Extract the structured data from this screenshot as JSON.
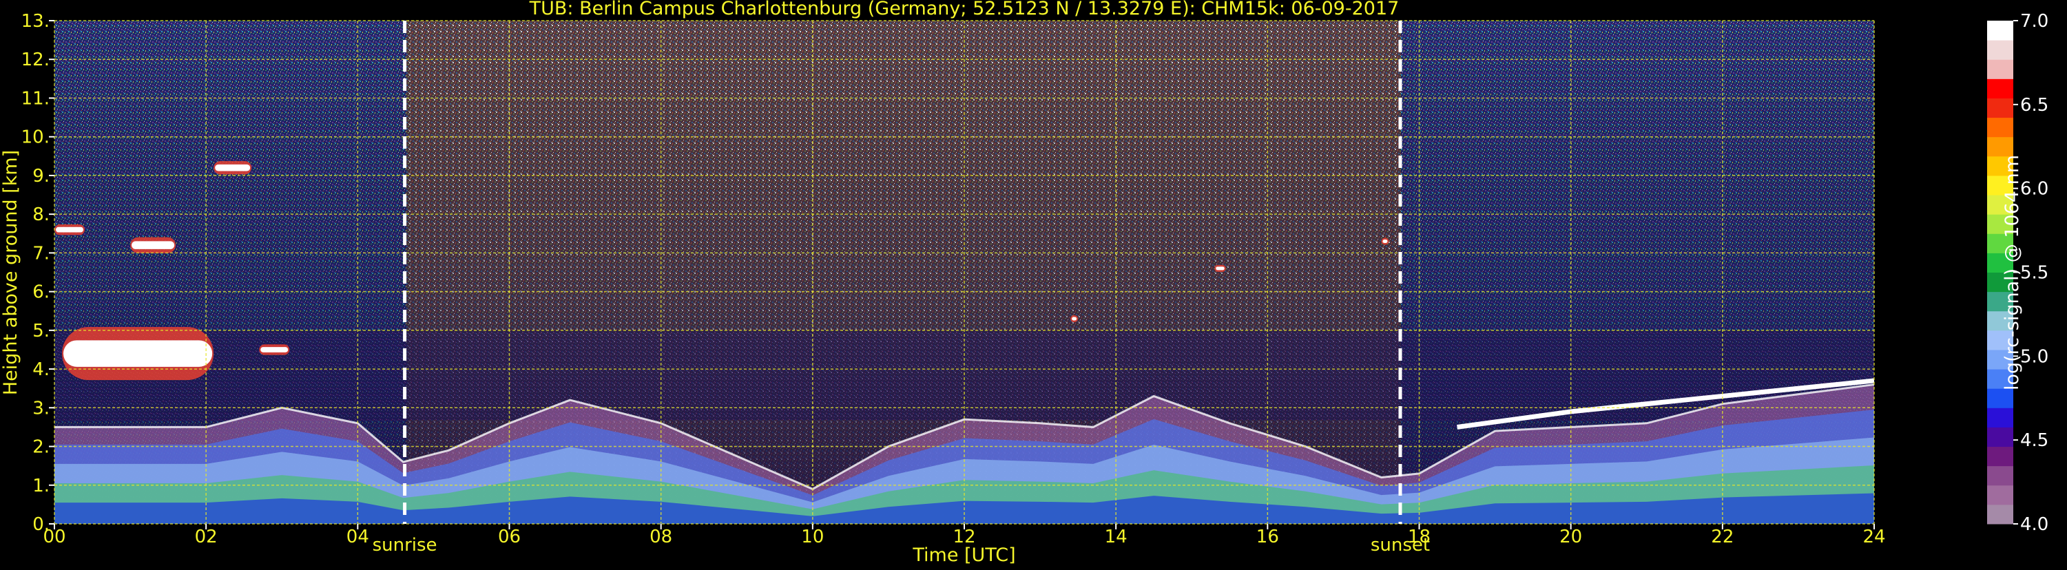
{
  "chart_data": {
    "type": "heatmap",
    "title": "TUB: Berlin Campus Charlottenburg (Germany; 52.5123 N / 13.3279 E):    CHM15k: 06-09-2017",
    "xlabel": "Time [UTC]",
    "ylabel": "Height above ground [km]",
    "x_range": [
      0,
      24
    ],
    "y_range": [
      0,
      13
    ],
    "x_tick_values": [
      0,
      2,
      4,
      6,
      8,
      10,
      12,
      14,
      16,
      18,
      20,
      22,
      24
    ],
    "x_tick_labels": [
      "00",
      "02",
      "04",
      "06",
      "08",
      "10",
      "12",
      "14",
      "16",
      "18",
      "20",
      "22",
      "24"
    ],
    "y_tick_values": [
      0,
      1,
      2,
      3,
      4,
      5,
      6,
      7,
      8,
      9,
      10,
      11,
      12,
      13
    ],
    "y_tick_labels": [
      "0.",
      "1.",
      "2.",
      "3.",
      "4.",
      "5.",
      "6.",
      "7.",
      "8.",
      "9.",
      "10.",
      "11.",
      "12.",
      "13."
    ],
    "grid": true,
    "annotations": [
      {
        "text": "sunrise",
        "x": 4.62
      },
      {
        "text": "sunset",
        "x": 17.75
      }
    ],
    "colorbar": {
      "label": "log(rc-signal) @ 1064 nm",
      "range": [
        4.0,
        7.0
      ],
      "tick_values": [
        4.0,
        4.5,
        5.0,
        5.5,
        6.0,
        6.5,
        7.0
      ],
      "tick_labels": [
        "4.0",
        "4.5",
        "5.0",
        "5.5",
        "6.0",
        "6.5",
        "7.0"
      ]
    },
    "features": [
      {
        "name": "boundary layer top",
        "points": [
          [
            0,
            2.5
          ],
          [
            2,
            2.5
          ],
          [
            3,
            3.0
          ],
          [
            4,
            2.6
          ],
          [
            4.6,
            1.6
          ],
          [
            5.2,
            1.9
          ],
          [
            6,
            2.6
          ],
          [
            6.8,
            3.2
          ],
          [
            8,
            2.6
          ],
          [
            10,
            0.9
          ],
          [
            11,
            2.0
          ],
          [
            12,
            2.7
          ],
          [
            13,
            2.6
          ],
          [
            13.7,
            2.5
          ],
          [
            14.5,
            3.3
          ],
          [
            15.5,
            2.6
          ],
          [
            16.5,
            2.0
          ],
          [
            17.5,
            1.2
          ],
          [
            18,
            1.3
          ],
          [
            19,
            2.4
          ],
          [
            20,
            2.5
          ],
          [
            21,
            2.6
          ],
          [
            22,
            3.1
          ],
          [
            24,
            3.6
          ]
        ]
      },
      {
        "name": "residual layer top",
        "points": [
          [
            18.5,
            2.5
          ],
          [
            20,
            2.9
          ],
          [
            22,
            3.3
          ],
          [
            24,
            3.7
          ]
        ]
      },
      {
        "name": "cloud 1",
        "x_range": [
          0.0,
          0.4
        ],
        "height": 7.6
      },
      {
        "name": "cloud 2",
        "x_range": [
          1.0,
          1.6
        ],
        "height": 7.2
      },
      {
        "name": "cloud 3",
        "x_range": [
          2.1,
          2.6
        ],
        "height": 9.2
      },
      {
        "name": "cloud 4",
        "x_range": [
          0.1,
          2.1
        ],
        "height": 4.4
      },
      {
        "name": "cloud 5",
        "x_range": [
          2.7,
          3.1
        ],
        "height": 4.5
      },
      {
        "name": "cloud 6",
        "x_range": [
          15.3,
          15.45
        ],
        "height": 6.6
      },
      {
        "name": "cloud 7",
        "x_range": [
          13.4,
          13.5
        ],
        "height": 5.3
      },
      {
        "name": "cloud 8",
        "x_range": [
          17.5,
          17.6
        ],
        "height": 7.3
      }
    ]
  }
}
